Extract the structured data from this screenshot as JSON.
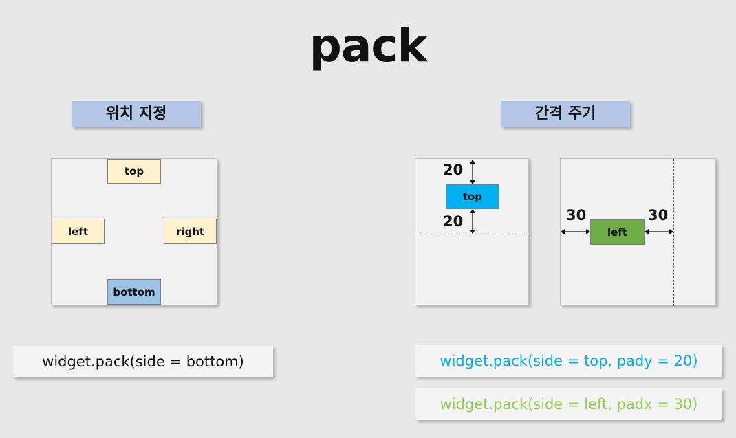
{
  "title": "pack",
  "sections": {
    "position": {
      "label": "위치 지정",
      "widgets": {
        "top": "top",
        "left": "left",
        "right": "right",
        "bottom": "bottom"
      },
      "code": "widget.pack(side = bottom)"
    },
    "spacing": {
      "label": "간격 주기",
      "pady_example": {
        "widget": "top",
        "pad_above": "20",
        "pad_below": "20"
      },
      "padx_example": {
        "widget": "left",
        "pad_left": "30",
        "pad_right": "30"
      },
      "code_pady": "widget.pack(side = top, pady = 20)",
      "code_padx": "widget.pack(side = left, padx = 30)"
    }
  },
  "colors": {
    "label_bg": "#b4c7e7",
    "widget_yellow": "#fff2cc",
    "widget_blue": "#9dc3e6",
    "top_widget": "#00b0f0",
    "left_widget": "#70ad47",
    "code_pady_text": "#00b0f0",
    "code_padx_text": "#92d050"
  }
}
